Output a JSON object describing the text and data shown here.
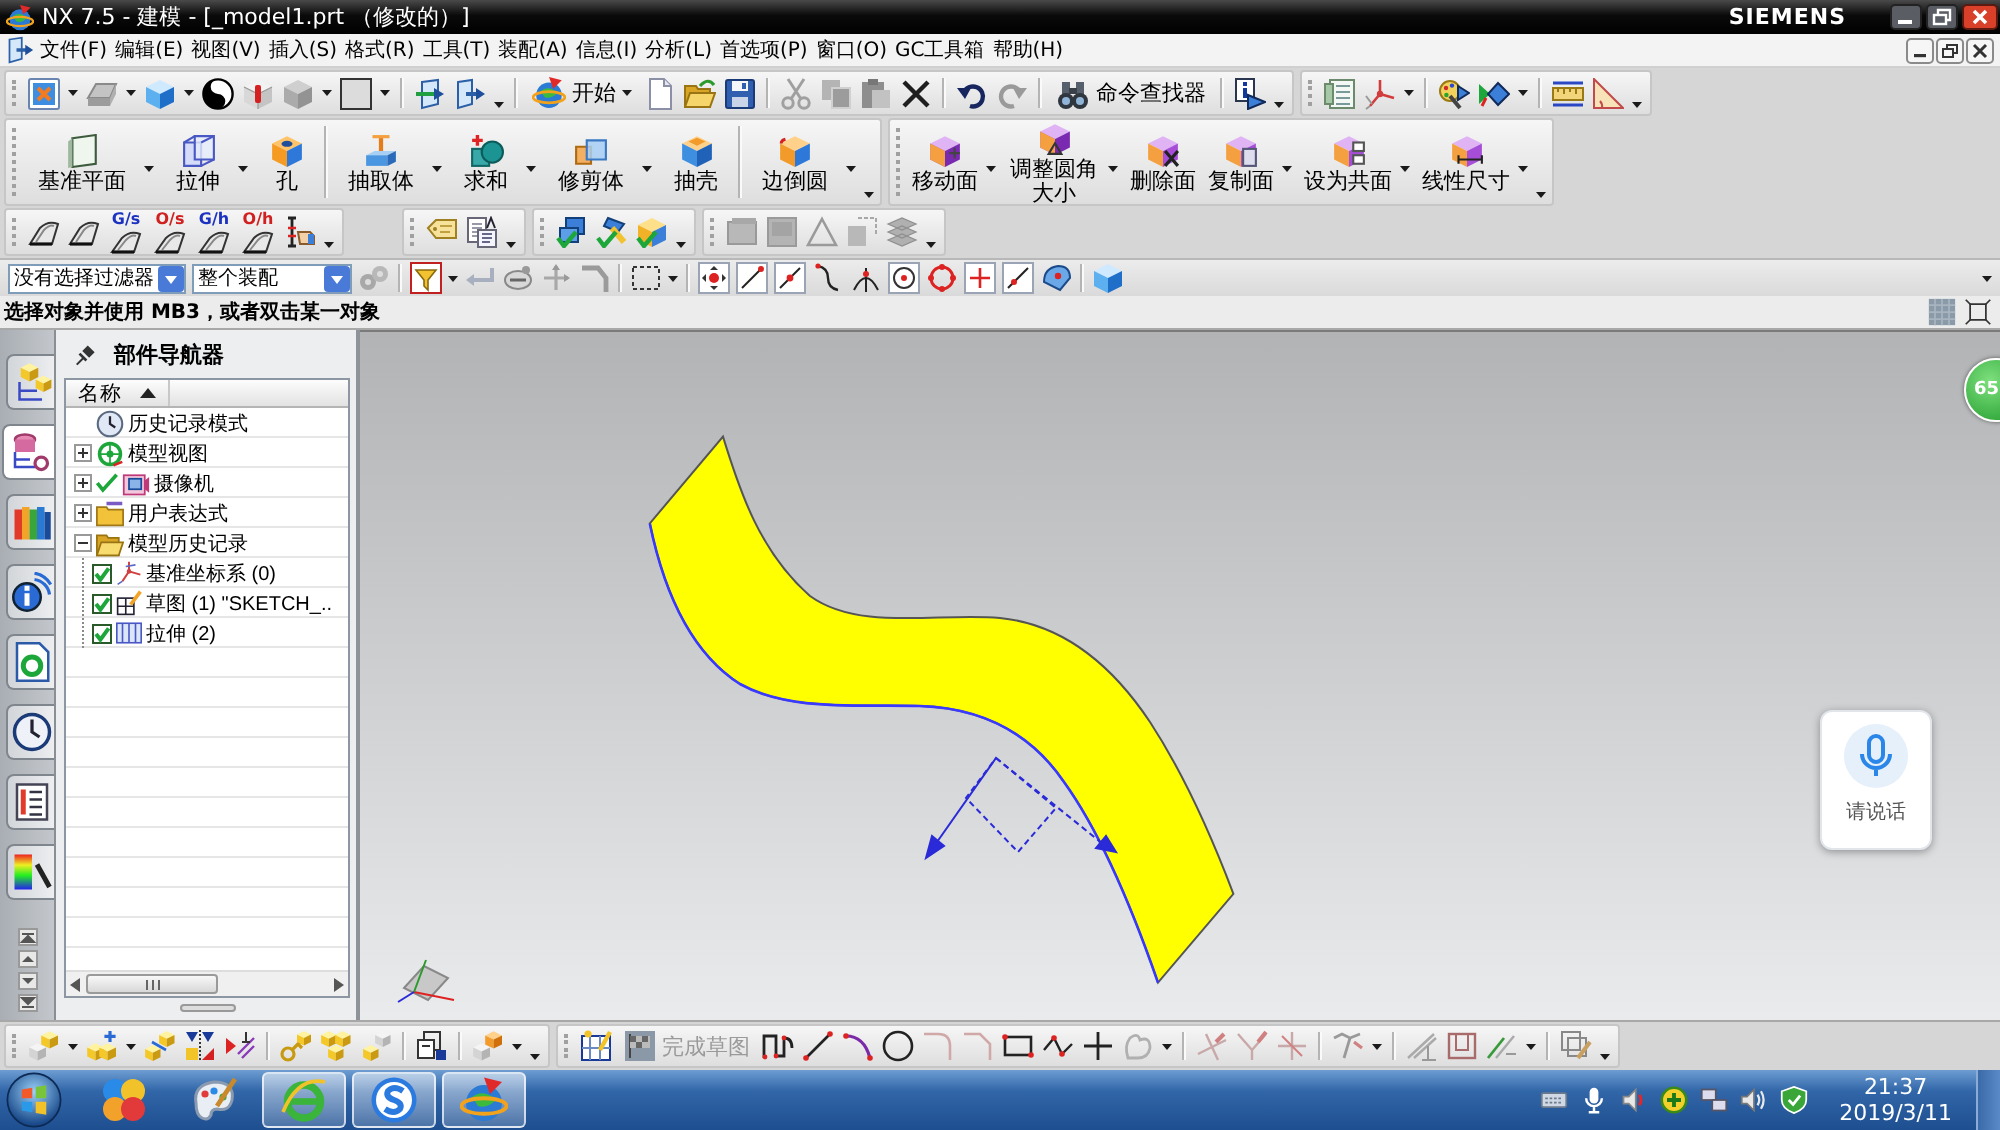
{
  "window": {
    "title": "NX 7.5 - 建模 - [_model1.prt （修改的）]",
    "brand": "SIEMENS"
  },
  "menu": [
    "文件(F)",
    "编辑(E)",
    "视图(V)",
    "插入(S)",
    "格式(R)",
    "工具(T)",
    "装配(A)",
    "信息(I)",
    "分析(L)",
    "首选项(P)",
    "窗口(O)",
    "GC工具箱",
    "帮助(H)"
  ],
  "standard_toolbar": {
    "start": "开始",
    "command_finder": "命令查找器"
  },
  "feature_toolbar": [
    {
      "sections": [
        {
          "buttons": [
            {
              "kind": "datum-plane",
              "label": "基准平面",
              "dropdown": true
            },
            {
              "kind": "extrude",
              "label": "拉伸",
              "dropdown": true
            },
            {
              "kind": "hole",
              "label": "孔",
              "dropdown": false
            }
          ]
        },
        {
          "buttons": [
            {
              "kind": "extract-body",
              "label": "抽取体",
              "dropdown": true
            },
            {
              "kind": "unite",
              "label": "求和",
              "dropdown": true
            },
            {
              "kind": "trim-body",
              "label": "修剪体",
              "dropdown": true
            },
            {
              "kind": "shell",
              "label": "抽壳",
              "dropdown": false
            }
          ]
        },
        {
          "buttons": [
            {
              "kind": "edge-blend",
              "label": "边倒圆",
              "dropdown": true
            }
          ]
        }
      ]
    },
    {
      "sections": [
        {
          "buttons": [
            {
              "kind": "move-face",
              "label": "移动面",
              "dropdown": true
            },
            {
              "kind": "resize-blend",
              "label": "调整圆角大小",
              "dropdown": true
            },
            {
              "kind": "delete-face",
              "label": "删除面",
              "dropdown": false
            },
            {
              "kind": "copy-face",
              "label": "复制面",
              "dropdown": true
            },
            {
              "kind": "make-coplanar",
              "label": "设为共面",
              "dropdown": true
            },
            {
              "kind": "linear-dimension",
              "label": "线性尺寸",
              "dropdown": true
            }
          ]
        }
      ]
    }
  ],
  "analysis_toolbar": [
    {
      "label": "G/s",
      "color": "#1c32c0"
    },
    {
      "label": "O/s",
      "color": "#d02020"
    },
    {
      "label": "G/h",
      "color": "#1c32c0"
    },
    {
      "label": "O/h",
      "color": "#d02020"
    }
  ],
  "selection_bar": {
    "filter": "没有选择过滤器",
    "scope": "整个装配"
  },
  "cue_line": "选择对象并使用 MB3，或者双击某一对象",
  "resource_bar": [
    {
      "kind": "assembly-navigator",
      "selected": false
    },
    {
      "kind": "part-navigator",
      "selected": true
    },
    {
      "kind": "reuse-library",
      "selected": false
    },
    {
      "kind": "hd3d",
      "selected": false
    },
    {
      "kind": "web-browser",
      "selected": false
    },
    {
      "kind": "history",
      "selected": false
    },
    {
      "kind": "system-materials",
      "selected": false
    },
    {
      "kind": "palette",
      "selected": false
    }
  ],
  "part_navigator": {
    "title": "部件导航器",
    "column": "名称",
    "items": [
      {
        "kind": "history-mode",
        "label": "历史记录模式"
      },
      {
        "kind": "model-views",
        "label": "模型视图",
        "expanded": false
      },
      {
        "kind": "cameras",
        "label": "摄像机",
        "expanded": false
      },
      {
        "kind": "expressions",
        "label": "用户表达式",
        "expanded": false
      },
      {
        "kind": "model-history",
        "label": "模型历史记录",
        "expanded": true,
        "children": [
          {
            "kind": "datum-csys",
            "label": "基准坐标系 (0)",
            "checked": true
          },
          {
            "kind": "sketch",
            "label": "草图 (1) \"SKETCH_..",
            "checked": true
          },
          {
            "kind": "extrude",
            "label": "拉伸 (2)",
            "checked": true
          }
        ]
      }
    ]
  },
  "graphics": {
    "badge": "65",
    "voice_prompt": "请说话"
  },
  "sketch_toolbar": {
    "finish_sketch": {
      "label": "完成草图",
      "disabled": true
    }
  },
  "taskbar": {
    "apps": [
      {
        "kind": "circles",
        "open": false
      },
      {
        "kind": "paint",
        "open": false
      },
      {
        "kind": "browser",
        "open": true
      },
      {
        "kind": "sogou",
        "open": true
      },
      {
        "kind": "nx",
        "open": true
      }
    ],
    "time": "21:37",
    "date": "2019/3/11"
  }
}
